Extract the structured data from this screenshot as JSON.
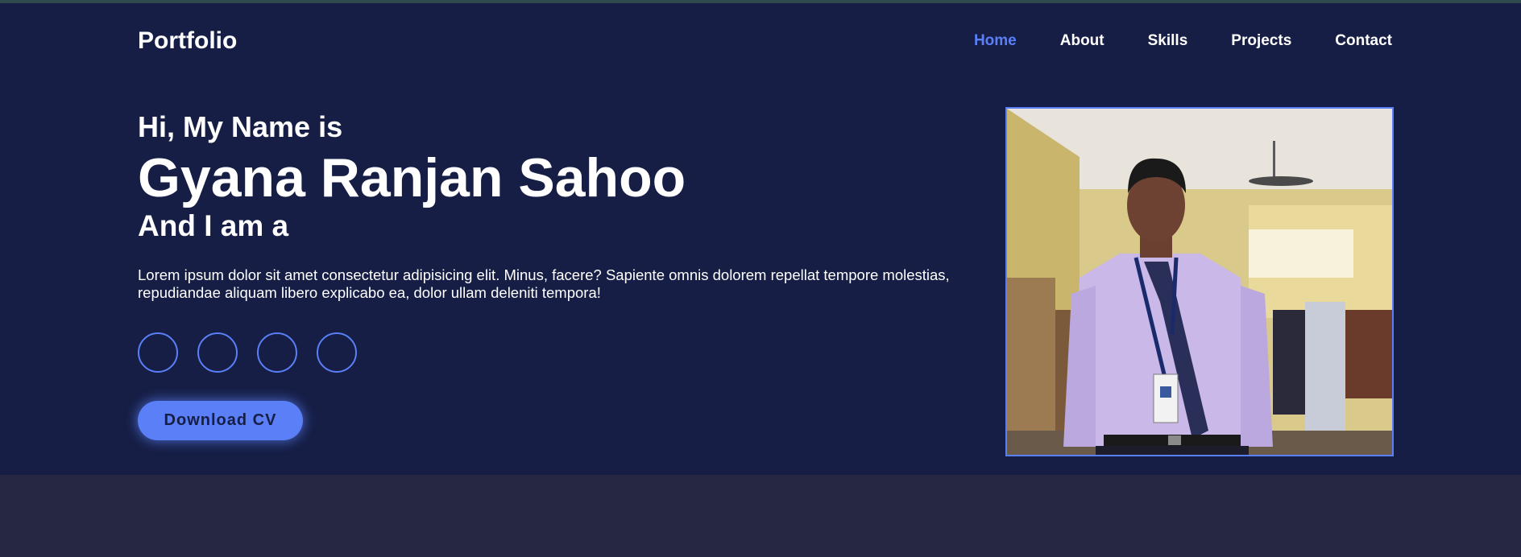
{
  "header": {
    "logo": "Portfolio",
    "nav": [
      {
        "label": "Home",
        "active": true
      },
      {
        "label": "About",
        "active": false
      },
      {
        "label": "Skills",
        "active": false
      },
      {
        "label": "Projects",
        "active": false
      },
      {
        "label": "Contact",
        "active": false
      }
    ]
  },
  "hero": {
    "greeting": "Hi, My Name is",
    "name": "Gyana Ranjan Sahoo",
    "role_prefix": "And I am a",
    "bio": "Lorem ipsum dolor sit amet consectetur adipisicing elit. Minus, facere? Sapiente omnis dolorem repellat tempore molestias, repudiandae aliquam libero explicabo ea, dolor ullam deleniti tempora!",
    "socials": [
      {
        "icon": "social-icon-1"
      },
      {
        "icon": "social-icon-2"
      },
      {
        "icon": "social-icon-3"
      },
      {
        "icon": "social-icon-4"
      }
    ],
    "cta_label": "Download CV"
  },
  "colors": {
    "hero_bg": "#161e45",
    "page_bg": "#262841",
    "accent": "#5a7ff7",
    "text": "#ffffff"
  }
}
